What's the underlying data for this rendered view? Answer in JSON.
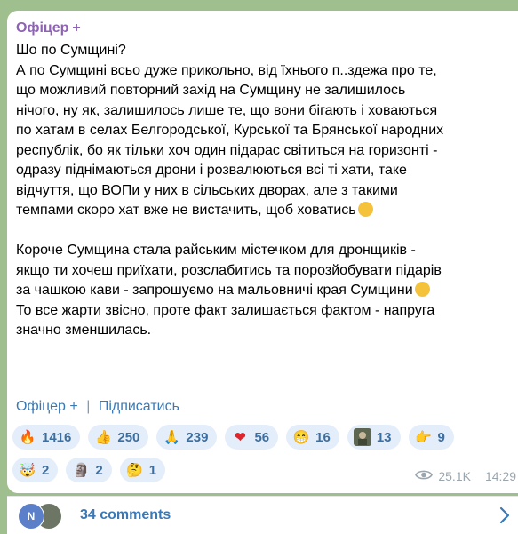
{
  "post": {
    "author": "Офіцер",
    "author_plus": "+",
    "lines": [
      "Шо по Сумщині?",
      "А по Сумщині всьо дуже прикольно, від їхнього п..здежа про те,",
      "що можливий повторний захід на Сумщину не залишилось",
      "нічого, ну як, залишилось лише те, що вони бігають і ховаються",
      "по хатам в селах Белгородської, Курської та Брянської народних",
      "республік, бо як тільки хоч один підарас світиться на горизонті -",
      "одразу піднімаються дрони і розвалюються всі ті хати, таке",
      "відчуття, що ВОПи у них в сільських дворах, але з такими",
      "темпами скоро хат вже не вистачить, щоб ховатись"
    ],
    "lines2": [
      "Короче Сумщина стала райським містечком для дронщиків -",
      "якщо ти хочеш приїхати, розслабитись та порозйобувати підарів",
      "за чашкою кави - запрошуємо на мальовничі края Сумщини",
      "То все жарти звісно, проте факт залишається фактом - напруга",
      "значно зменшилась."
    ],
    "signature": {
      "name": "Офіцер",
      "plus": "+",
      "separator": "|",
      "subscribe": "Підписатись"
    }
  },
  "reactions": {
    "row1": [
      {
        "icon": "fire-icon",
        "glyph": "🔥",
        "count": "1416"
      },
      {
        "icon": "thumbs-up-icon",
        "glyph": "👍",
        "count": "250"
      },
      {
        "icon": "pray-icon",
        "glyph": "🙏",
        "count": "239"
      },
      {
        "icon": "heart-icon",
        "glyph": "❤",
        "count": "56"
      },
      {
        "icon": "grin-icon",
        "glyph": "😁",
        "count": "16"
      },
      {
        "icon": "custom-soldier-icon",
        "glyph": "",
        "count": "13"
      },
      {
        "icon": "point-icon",
        "glyph": "👉",
        "count": "9"
      }
    ],
    "row2": [
      {
        "icon": "angry-face-icon",
        "glyph": "🤯",
        "count": "2"
      },
      {
        "icon": "moai-icon",
        "glyph": "🗿",
        "count": "2"
      },
      {
        "icon": "thinking-icon",
        "glyph": "🤔",
        "count": "1"
      }
    ]
  },
  "meta": {
    "views": "25.1K",
    "time": "14:29"
  },
  "comments": {
    "avatar_letter": "N",
    "label": "34 comments"
  },
  "colors": {
    "background": "#9fbf8e",
    "author": "#8e63b5",
    "link": "#3a79b5",
    "chip": "#e4eefa"
  }
}
